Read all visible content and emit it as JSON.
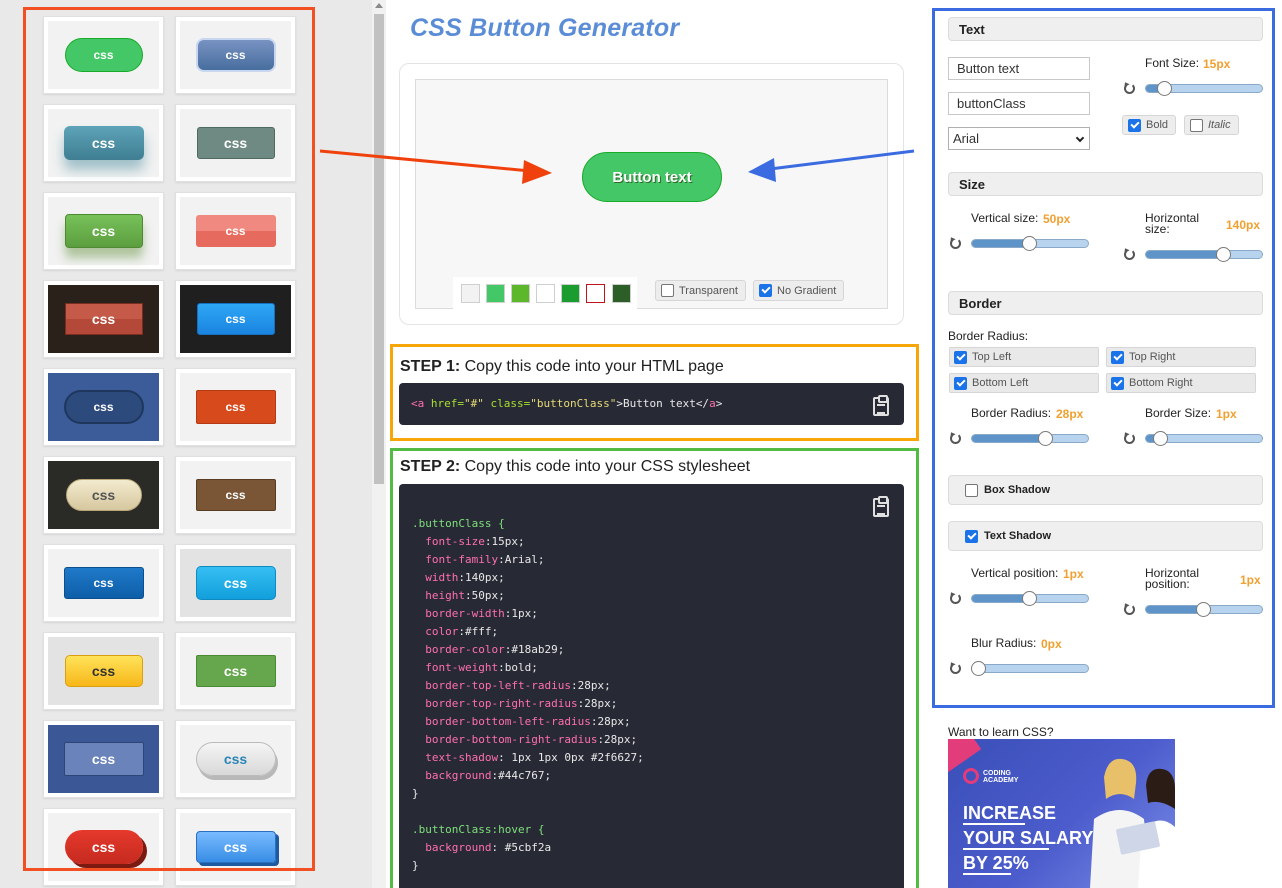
{
  "title": "CSS Button Generator",
  "gallery": {
    "button_label": "css"
  },
  "preview": {
    "button_text": "Button text",
    "transparent_label": "Transparent",
    "no_gradient_label": "No Gradient",
    "swatches": [
      "#f2f2f2",
      "#44c767",
      "#5cb82a",
      "#ffffff",
      "#1a9c2e",
      "#ffffff",
      "#2d5e27"
    ]
  },
  "step1": {
    "label": "STEP 1:",
    "text": "Copy this code into your HTML page",
    "code_open": "<a",
    "code_attr1": "href=",
    "code_val1": "\"#\"",
    "code_attr2": "class=",
    "code_val2": "\"buttonClass\"",
    "code_text": ">Button text</",
    "code_close": "a",
    "code_end": ">"
  },
  "step2": {
    "label": "STEP 2:",
    "text": "Copy this code into your CSS stylesheet",
    "selector": ".buttonClass {",
    "props": [
      {
        "p": "font-size",
        "v": ":15px;"
      },
      {
        "p": "font-family",
        "v": ":Arial;"
      },
      {
        "p": "width",
        "v": ":140px;"
      },
      {
        "p": "height",
        "v": ":50px;"
      },
      {
        "p": "border-width",
        "v": ":1px;"
      },
      {
        "p": "color",
        "v": ":#fff;"
      },
      {
        "p": "border-color",
        "v": ":#18ab29;"
      },
      {
        "p": "font-weight",
        "v": ":bold;"
      },
      {
        "p": "border-top-left-radius",
        "v": ":28px;"
      },
      {
        "p": "border-top-right-radius",
        "v": ":28px;"
      },
      {
        "p": "border-bottom-left-radius",
        "v": ":28px;"
      },
      {
        "p": "border-bottom-right-radius",
        "v": ":28px;"
      },
      {
        "p": "text-shadow",
        "v": ": 1px 1px 0px #2f6627;"
      },
      {
        "p": "background",
        "v": ":#44c767;"
      }
    ],
    "close": "}",
    "hover_selector": ".buttonClass:hover {",
    "hover_prop": "background",
    "hover_val": ": #5cbf2a",
    "hover_close": "}"
  },
  "panel": {
    "text_section": "Text",
    "button_text_value": "Button text",
    "class_value": "buttonClass",
    "font_value": "Arial",
    "font_size_label": "Font Size:",
    "font_size_value": "15px",
    "bold_label": "Bold",
    "italic_label": "Italic",
    "size_section": "Size",
    "vertical_size_label": "Vertical size:",
    "vertical_size_value": "50px",
    "horizontal_size_label_1": "Horizontal",
    "horizontal_size_label_2": "size:",
    "horizontal_size_value": "140px",
    "border_section": "Border",
    "border_radius_caption": "Border Radius:",
    "top_left": "Top Left",
    "top_right": "Top Right",
    "bottom_left": "Bottom Left",
    "bottom_right": "Bottom Right",
    "border_radius_label": "Border Radius:",
    "border_radius_value": "28px",
    "border_size_label": "Border Size:",
    "border_size_value": "1px",
    "box_shadow_section": "Box Shadow",
    "text_shadow_section": "Text Shadow",
    "vertical_position_label": "Vertical position:",
    "vertical_position_value": "1px",
    "horizontal_position_label_1": "Horizontal",
    "horizontal_position_label_2": "position:",
    "horizontal_position_value": "1px",
    "blur_radius_label": "Blur Radius:",
    "blur_radius_value": "0px",
    "sliders": {
      "font_size": 0.12,
      "vertical_size": 0.5,
      "horizontal_size": 0.7,
      "border_radius": 0.66,
      "border_size": 0.08,
      "vertical_position": 0.5,
      "horizontal_position": 0.5,
      "blur_radius": 0.0
    }
  },
  "ad": {
    "question": "Want to learn CSS?",
    "logo_line1": "CODING",
    "logo_line2": "ACADEMY",
    "line1": "INCREASE",
    "line2": "YOUR SALARY",
    "line3": "BY 25%"
  },
  "colors": {
    "gallery_frame": "#f25022",
    "step1_frame": "#f6a609",
    "step2_frame": "#53ba44",
    "panel_frame": "#3b6be0",
    "accent_value": "#f0a030",
    "title": "#5b8dd6"
  }
}
